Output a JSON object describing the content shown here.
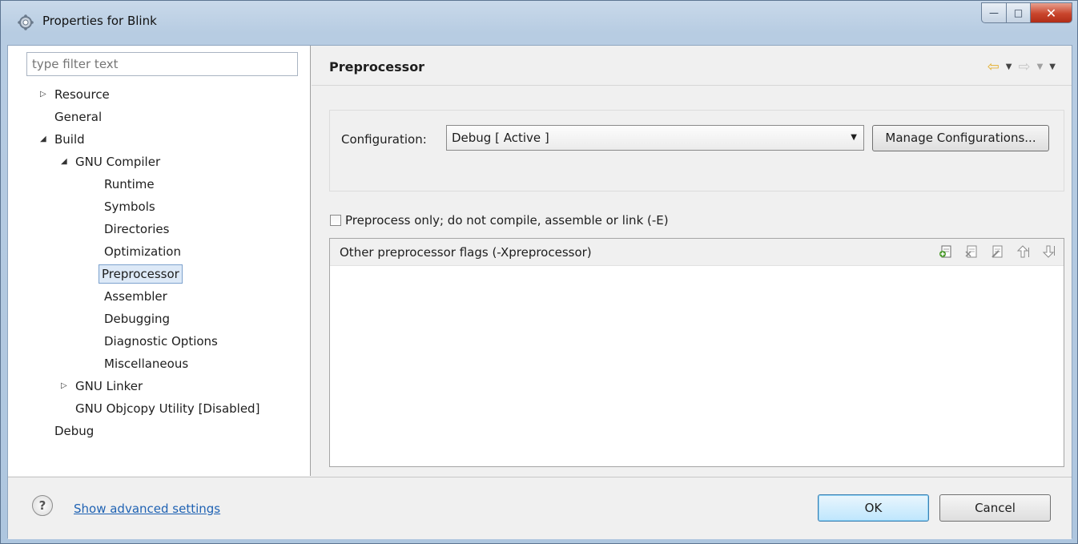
{
  "window": {
    "title": "Properties for Blink",
    "minimize_glyph": "—",
    "maximize_glyph": "□",
    "close_glyph": "✕"
  },
  "filter": {
    "placeholder": "type filter text"
  },
  "tree": [
    {
      "label": "Resource",
      "expander": "▷"
    },
    {
      "label": "General",
      "expander": ""
    },
    {
      "label": "Build",
      "expander": "◢"
    },
    {
      "label": "GNU Compiler",
      "expander": "◢"
    },
    {
      "label": "Runtime",
      "expander": ""
    },
    {
      "label": "Symbols",
      "expander": ""
    },
    {
      "label": "Directories",
      "expander": ""
    },
    {
      "label": "Optimization",
      "expander": ""
    },
    {
      "label": "Preprocessor",
      "expander": "",
      "selected": true
    },
    {
      "label": "Assembler",
      "expander": ""
    },
    {
      "label": "Debugging",
      "expander": ""
    },
    {
      "label": "Diagnostic Options",
      "expander": ""
    },
    {
      "label": "Miscellaneous",
      "expander": ""
    },
    {
      "label": "GNU Linker",
      "expander": "▷"
    },
    {
      "label": "GNU Objcopy Utility  [Disabled]",
      "expander": ""
    },
    {
      "label": "Debug",
      "expander": ""
    }
  ],
  "page": {
    "title": "Preprocessor",
    "nav": {
      "back_icon": "⇦",
      "forward_icon": "⇨",
      "menu_arrow": "▼"
    }
  },
  "configuration": {
    "label": "Configuration:",
    "value": "Debug  [ Active ]",
    "manage_label": "Manage Configurations..."
  },
  "preprocess_only": {
    "label": "Preprocess only; do not compile, assemble or link (-E)",
    "checked": false
  },
  "flags": {
    "title": "Other preprocessor flags (-Xpreprocessor)",
    "items": [],
    "toolbar_icons": [
      "add-icon",
      "delete-icon",
      "edit-icon",
      "move-up-icon",
      "move-down-icon"
    ]
  },
  "footer": {
    "help_glyph": "?",
    "advanced_link": "Show advanced settings",
    "ok_label": "OK",
    "cancel_label": "Cancel"
  },
  "colors": {
    "selection_bg": "#dde9f7",
    "selection_border": "#7da2ce",
    "link": "#1f62b3",
    "back_arrow": "#e5b236",
    "ok_default_border": "#3c7fb1"
  }
}
